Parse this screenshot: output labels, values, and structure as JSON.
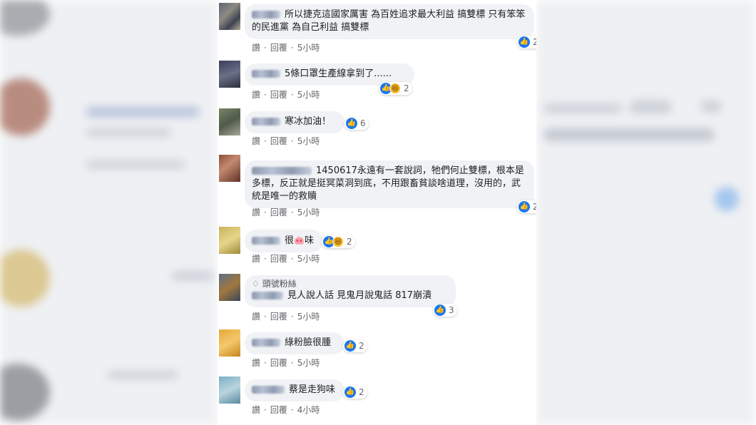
{
  "actions": {
    "like": "讚",
    "reply": "回覆",
    "dot": "·"
  },
  "comments": [
    {
      "text": "所以捷克這國家厲害 為百姓追求最大利益 搞雙標 只有笨笨的民進黨 為自己利益 搞雙標",
      "time": "5小時",
      "count": "2"
    },
    {
      "text": "5條口罩生產線拿到了......",
      "time": "5小時",
      "count": "2"
    },
    {
      "text": "寒冰加油！",
      "time": "5小時",
      "count": "6"
    },
    {
      "text": "1450617永遠有一套說詞，牠們何止雙標，根本是多標，反正就是挺冥菜洞到底，不用跟畜貧談啥道理，沒用的，武統是唯一的救贖",
      "time": "5小時",
      "count": "2"
    },
    {
      "text_pre": "很",
      "emoji": "🐽",
      "text_post": "味",
      "time": "5小時",
      "count": "2"
    },
    {
      "badge": "頭號粉絲",
      "text": "見人說人話 見鬼月說鬼話 817崩潰",
      "time": "5小時",
      "count": "3"
    },
    {
      "text": "綠粉臉很腫",
      "time": "5小時",
      "count": "2"
    },
    {
      "text": "蔡是走狗味",
      "time": "4小時",
      "count": "2"
    }
  ],
  "colors": {
    "like": "#1877f2",
    "bubble": "#f0f2f5",
    "meta": "#65676b"
  }
}
